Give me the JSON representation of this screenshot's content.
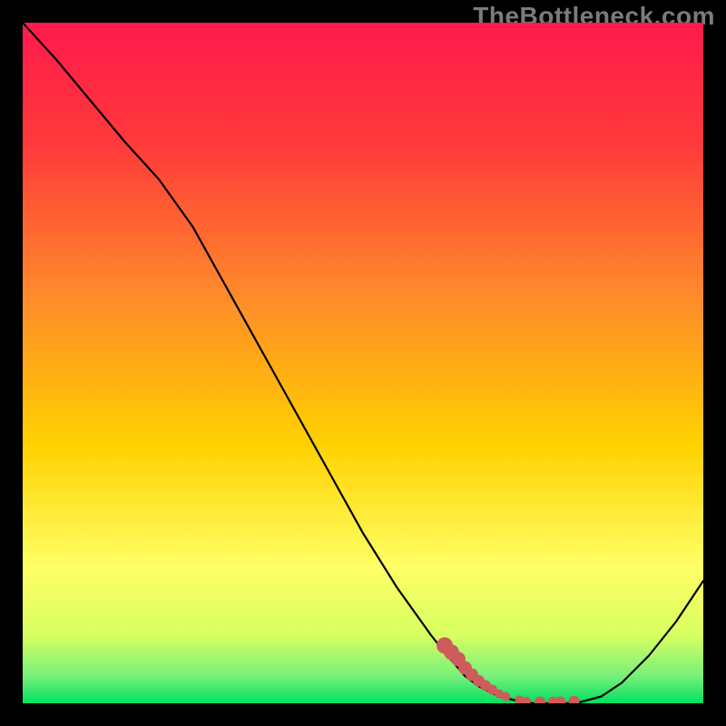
{
  "watermark": "TheBottleneck.com",
  "chart_data": {
    "type": "line",
    "title": "",
    "xlabel": "",
    "ylabel": "",
    "xlim": [
      0,
      100
    ],
    "ylim": [
      0,
      100
    ],
    "grid": false,
    "series": [
      {
        "name": "curve",
        "x": [
          0,
          5,
          10,
          15,
          20,
          25,
          30,
          35,
          40,
          45,
          50,
          55,
          60,
          62,
          65,
          67,
          70,
          73,
          75,
          77,
          80,
          82,
          85,
          88,
          92,
          96,
          100
        ],
        "y": [
          100,
          94.5,
          88.5,
          82.5,
          77,
          70,
          61,
          52,
          43,
          34,
          25,
          17,
          10,
          7.5,
          4,
          2.5,
          1,
          0.3,
          0,
          0,
          0,
          0.2,
          1,
          3,
          7,
          12,
          18
        ],
        "color": "#000000"
      },
      {
        "name": "highlight",
        "x": [
          62,
          63,
          64,
          65,
          66,
          67,
          68,
          69,
          70,
          71,
          73,
          74,
          76,
          78,
          79,
          81
        ],
        "y": [
          8.5,
          7.5,
          6.5,
          5.2,
          4.2,
          3.3,
          2.6,
          2,
          1.4,
          1,
          0.5,
          0.3,
          0.2,
          0.2,
          0.2,
          0.3
        ],
        "color": "#cf5b5b"
      }
    ],
    "background_gradient": {
      "top": "#ff1a4d",
      "mid": "#ffd100",
      "low": "#ffff66",
      "bottom": "#00e060"
    }
  }
}
